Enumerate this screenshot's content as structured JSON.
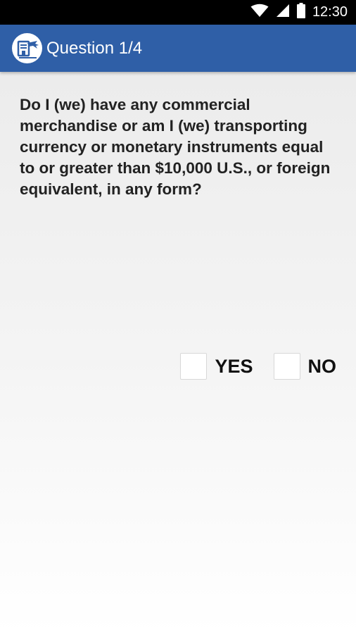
{
  "status_bar": {
    "time": "12:30",
    "icons": [
      "wifi-icon",
      "signal-icon",
      "battery-icon"
    ]
  },
  "app_bar": {
    "title": "Question 1/4",
    "logo": "travel-declaration-logo-icon",
    "color": "#2f5fa7"
  },
  "question": {
    "text": "Do I (we) have any commercial merchandise or am I (we) transporting currency or monetary instruments equal to or greater than $10,000 U.S., or foreign equivalent, in any form?"
  },
  "answers": {
    "yes_label": "YES",
    "no_label": "NO",
    "yes_checked": false,
    "no_checked": false
  }
}
